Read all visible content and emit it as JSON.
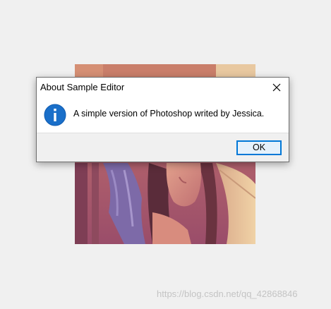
{
  "dialog": {
    "title": "About Sample Editor",
    "message": "A simple version of Photoshop writed by Jessica.",
    "ok_label": "OK",
    "icon": "info-icon",
    "close_icon": "close-icon"
  },
  "background_image": {
    "description_icon": "photo-image"
  },
  "watermark": {
    "text": "https://blog.csdn.net/qq_42868846"
  },
  "colors": {
    "accent": "#0078d7",
    "button_fill": "#e5f1fb",
    "window_bg": "#f0f0f0",
    "info_icon": "#1a6fc9"
  }
}
